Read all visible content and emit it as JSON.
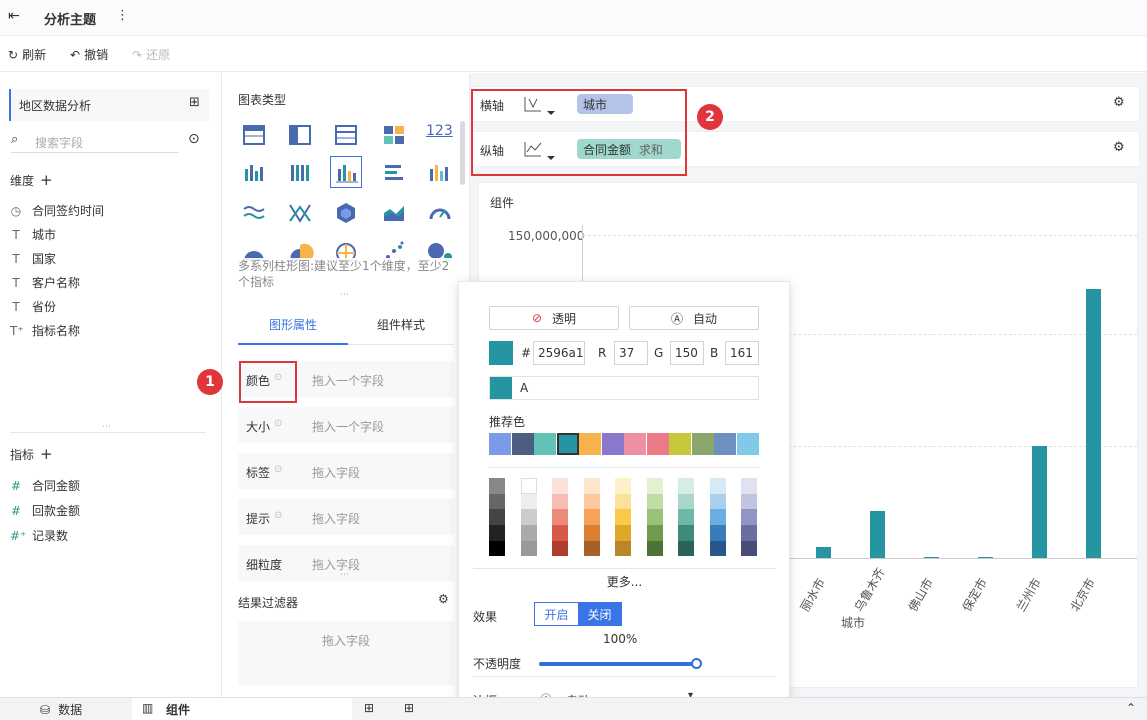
{
  "header": {
    "title": "分析主题",
    "more": "⋮"
  },
  "toolbar": {
    "refresh": "刷新",
    "undo": "撤销",
    "redo": "还原"
  },
  "left": {
    "dataset": "地区数据分析",
    "search_placeholder": "搜索字段",
    "dimension_title": "维度",
    "dimensions": [
      "合同签约时间",
      "城市",
      "国家",
      "客户名称",
      "省份",
      "指标名称"
    ],
    "measure_title": "指标",
    "measures": [
      "合同金额",
      "回款金额",
      "记录数"
    ]
  },
  "middle": {
    "chart_type_title": "图表类型",
    "hint": "多系列柱形图:建议至少1个维度，至少2个指标",
    "tab_shape": "图形属性",
    "tab_style": "组件样式",
    "props": [
      {
        "label": "颜色",
        "placeholder": "拖入一个字段"
      },
      {
        "label": "大小",
        "placeholder": "拖入一个字段"
      },
      {
        "label": "标签",
        "placeholder": "拖入字段"
      },
      {
        "label": "提示",
        "placeholder": "拖入字段"
      },
      {
        "label": "细粒度",
        "placeholder": "拖入字段"
      }
    ],
    "filter_title": "结果过滤器",
    "filter_placeholder": "拖入字段"
  },
  "axes": {
    "x_label": "横轴",
    "x_field": "城市",
    "y_label": "纵轴",
    "y_field": "合同金额",
    "y_agg": "求和"
  },
  "chart": {
    "component_title": "组件",
    "ytick_top": "150,000,000",
    "x_title": "城市"
  },
  "chart_data": {
    "type": "bar",
    "categories": [
      "丽水市",
      "乌鲁木齐",
      "佛山市",
      "保定市",
      "兰州市",
      "北京市"
    ],
    "values": [
      5000000,
      22000000,
      500000,
      500000,
      52000000,
      125000000
    ],
    "ylabel": "",
    "xlabel": "城市",
    "color": "#2596a1"
  },
  "popup": {
    "transparent": "透明",
    "auto": "自动",
    "hash": "#",
    "hex": "2596a1",
    "r_label": "R",
    "r": "37",
    "g_label": "G",
    "g": "150",
    "b_label": "B",
    "b": "161",
    "recent_label": "A",
    "recommend_title": "推荐色",
    "recommend": [
      "#7b9be8",
      "#4d5f80",
      "#63c2b8",
      "#2596a1",
      "#f7b24a",
      "#8a78cc",
      "#ee8fa4",
      "#e97a86",
      "#c6c73a",
      "#8aa86e",
      "#6f8fc0",
      "#7fc8e8"
    ],
    "more": "更多...",
    "effect_label": "效果",
    "effect_on": "开启",
    "effect_off": "关闭",
    "opacity_value": "100%",
    "opacity_label": "不透明度",
    "border_label": "边框",
    "border_value": "自动"
  },
  "annotations": {
    "badge1": "1",
    "badge2": "2"
  },
  "bottom": {
    "data_tab": "数据",
    "component_tab": "组件"
  }
}
